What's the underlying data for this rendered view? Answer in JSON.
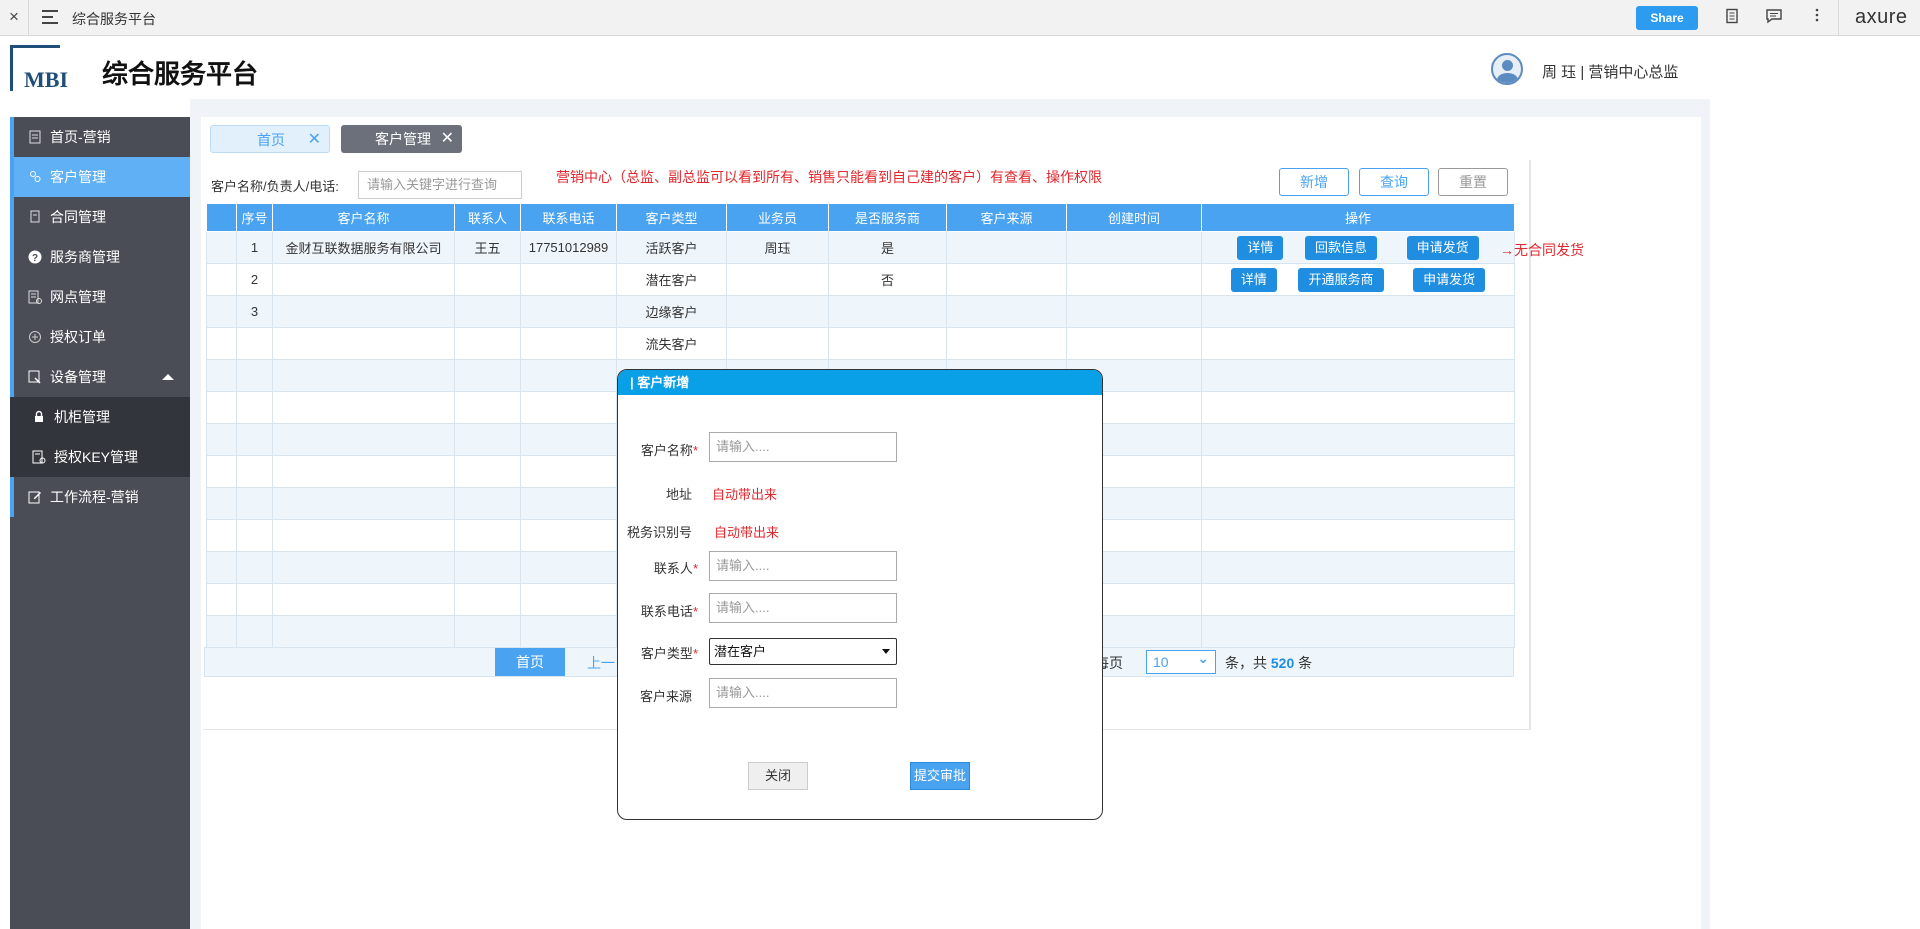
{
  "topbar": {
    "close": "×",
    "page_title": "综合服务平台",
    "share": "Share",
    "brand": "axure"
  },
  "header": {
    "logo_text": "MBI",
    "app_title": "综合服务平台",
    "user": "周 珏 | 营销中心总监"
  },
  "sidebar": {
    "items": [
      {
        "label": "首页-营销",
        "icon": "home-doc-icon"
      },
      {
        "label": "客户管理",
        "icon": "users-icon"
      },
      {
        "label": "合同管理",
        "icon": "contract-icon"
      },
      {
        "label": "服务商管理",
        "icon": "help-circle-icon"
      },
      {
        "label": "网点管理",
        "icon": "network-doc-icon"
      },
      {
        "label": "授权订单",
        "icon": "order-icon"
      },
      {
        "label": "设备管理",
        "icon": "device-icon"
      },
      {
        "label": "机柜管理",
        "icon": "lock-icon"
      },
      {
        "label": "授权KEY管理",
        "icon": "key-doc-icon"
      },
      {
        "label": "工作流程-营销",
        "icon": "edit-icon"
      }
    ]
  },
  "tabs": [
    {
      "label": "首页"
    },
    {
      "label": "客户管理"
    }
  ],
  "search": {
    "label": "客户名称/负责人/电话:",
    "placeholder": "请输入关键字进行查询",
    "note": "营销中心（总监、副总监可以看到所有、销售只能看到自己建的客户）有查看、操作权限",
    "add": "新增",
    "query": "查询",
    "reset": "重置"
  },
  "table": {
    "headers": [
      "",
      "序号",
      "客户名称",
      "联系人",
      "联系电话",
      "客户类型",
      "业务员",
      "是否服务商",
      "客户来源",
      "创建时间",
      "操作"
    ],
    "rows": [
      {
        "no": "1",
        "name": "金财互联数据服务有限公司",
        "contact": "王五",
        "phone": "17751012989",
        "type": "活跃客户",
        "sales": "周珏",
        "is_sp": "是",
        "source": "",
        "created": "",
        "actions": [
          "详情",
          "回款信息",
          "申请发货"
        ]
      },
      {
        "no": "2",
        "name": "",
        "contact": "",
        "phone": "",
        "type": "潜在客户",
        "sales": "",
        "is_sp": "否",
        "source": "",
        "created": "",
        "actions": [
          "详情",
          "开通服务商",
          "申请发货"
        ]
      },
      {
        "no": "3",
        "name": "",
        "contact": "",
        "phone": "",
        "type": "边缘客户",
        "sales": "",
        "is_sp": "",
        "source": "",
        "created": "",
        "actions": []
      },
      {
        "no": "",
        "name": "",
        "contact": "",
        "phone": "",
        "type": "流失客户",
        "sales": "",
        "is_sp": "",
        "source": "",
        "created": "",
        "actions": []
      }
    ],
    "side_note": "→无合同发货"
  },
  "pager": {
    "first": "首页",
    "prev": "上一",
    "per_page": "每页",
    "page_size": "10",
    "total_prefix": "条，共",
    "total": "520",
    "total_suffix": "条"
  },
  "modal": {
    "title": "| 客户新增",
    "name_label": "客户名称",
    "address_label": "地址",
    "tax_label": "税务识别号",
    "contact_label": "联系人",
    "phone_label": "联系电话",
    "type_label": "客户类型",
    "source_label": "客户来源",
    "placeholder": "请输入....",
    "auto_text": "自动带出来",
    "type_value": "潜在客户",
    "close": "关闭",
    "submit": "提交审批"
  }
}
